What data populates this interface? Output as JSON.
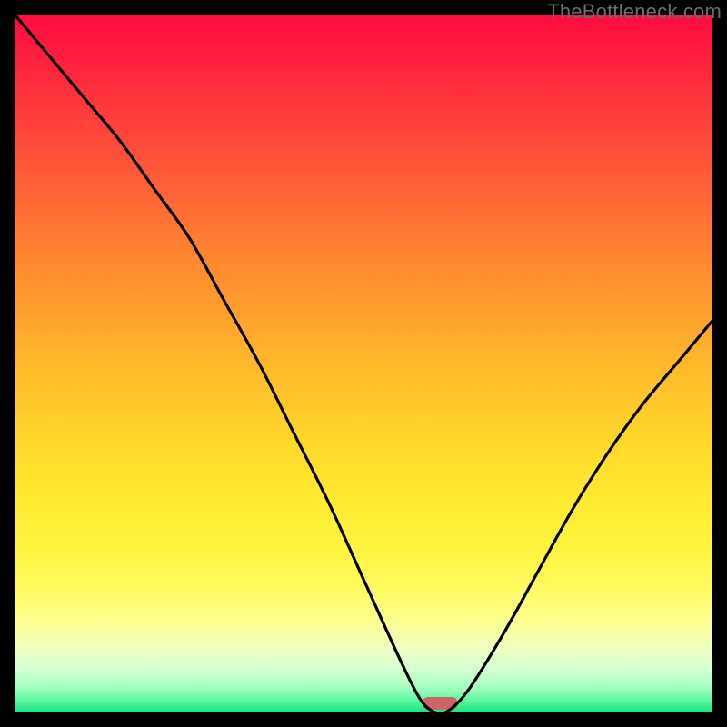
{
  "attribution": "TheBottleneck.com",
  "chart_data": {
    "type": "line",
    "title": "",
    "xlabel": "",
    "ylabel": "",
    "xlim": [
      0,
      100
    ],
    "ylim": [
      0,
      100
    ],
    "grid": false,
    "series": [
      {
        "name": "bottleneck-curve",
        "x": [
          0,
          5,
          10,
          15,
          20,
          25,
          30,
          35,
          40,
          45,
          50,
          55,
          58,
          60,
          62,
          65,
          70,
          75,
          80,
          85,
          90,
          95,
          100
        ],
        "values": [
          100,
          94,
          88,
          82,
          75,
          68,
          59,
          50,
          40,
          30,
          19,
          8,
          2,
          0,
          0,
          3,
          11,
          20,
          29,
          37,
          44,
          50,
          56
        ]
      }
    ],
    "marker": {
      "name": "optimal-zone",
      "x_center": 61,
      "width": 5,
      "color": "#cc6666"
    },
    "background_gradient": {
      "stops": [
        {
          "t": 0.0,
          "color": "#ff0c3f"
        },
        {
          "t": 0.5,
          "color": "#ffc729"
        },
        {
          "t": 0.85,
          "color": "#fffb5c"
        },
        {
          "t": 1.0,
          "color": "#19e77f"
        }
      ]
    }
  }
}
